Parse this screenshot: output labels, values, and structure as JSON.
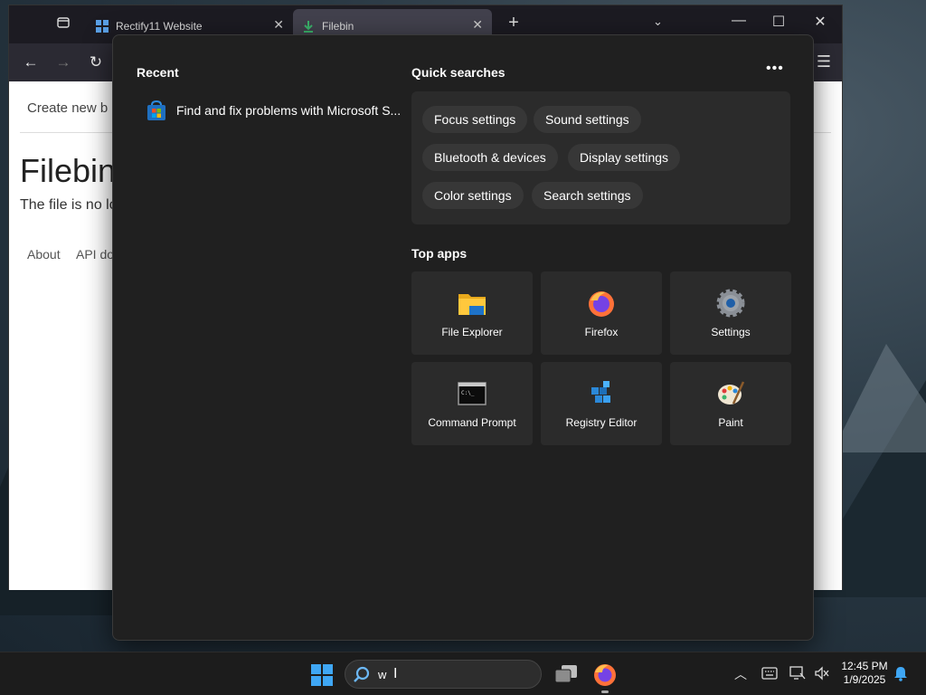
{
  "browser": {
    "tabs": [
      {
        "title": "Rectify11 Website",
        "active": false
      },
      {
        "title": "Filebin",
        "active": true
      }
    ],
    "new_tab": "+",
    "page": {
      "create_link": "Create new b",
      "heading": "Filebin",
      "message": "The file is no lo",
      "footer_about": "About",
      "footer_api": "API do"
    }
  },
  "flyout": {
    "recent_title": "Recent",
    "recent_items": [
      {
        "label": "Find and fix problems with Microsoft S...",
        "icon": "microsoft-store-icon"
      }
    ],
    "quick_searches_title": "Quick searches",
    "quick_searches": [
      "Focus settings",
      "Sound settings",
      "Bluetooth & devices",
      "Display settings",
      "Color settings",
      "Search settings"
    ],
    "top_apps_title": "Top apps",
    "top_apps": [
      {
        "name": "File Explorer",
        "icon": "folder-icon"
      },
      {
        "name": "Firefox",
        "icon": "firefox-icon"
      },
      {
        "name": "Settings",
        "icon": "gear-icon"
      },
      {
        "name": "Command Prompt",
        "icon": "terminal-icon"
      },
      {
        "name": "Registry Editor",
        "icon": "registry-icon"
      },
      {
        "name": "Paint",
        "icon": "palette-icon"
      }
    ]
  },
  "taskbar": {
    "search_value": "w",
    "clock": {
      "time": "12:45 PM",
      "date": "1/9/2025"
    }
  },
  "colors": {
    "flyout_bg": "#202020",
    "chip_bg": "#373737",
    "taskbar_bg": "#1c1c1c",
    "accent": "#0078d4"
  }
}
